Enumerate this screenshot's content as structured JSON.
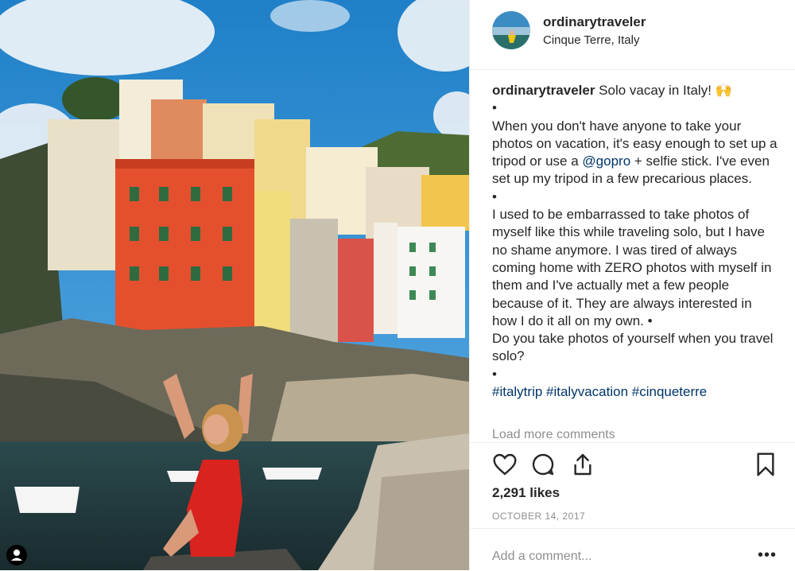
{
  "post": {
    "username": "ordinarytraveler",
    "location": "Cinque Terre, Italy",
    "caption": {
      "username": "ordinarytraveler",
      "line_intro": " Solo vacay in Italy! 🙌",
      "bullet": "•",
      "para1_a": "When you don't have anyone to take your photos on vacation, it's easy enough to set up a tripod or use a ",
      "mention": "@gopro",
      "para1_b": " + selfie stick. I've even set up my tripod in a few precarious places.",
      "para2": "I used to be embarrassed to take photos of myself like this while traveling solo, but I have no shame anymore. I was tired of always coming home with ZERO photos with myself in them and I've actually met a few people because of it. They are always interested in how I do it all on my own. •",
      "para3": "Do you take photos of yourself when you travel solo?",
      "hashtags": "#italytrip #italyvacation #cinqueterre"
    },
    "load_more": "Load more comments",
    "likes": "2,291 likes",
    "date": "OCTOBER 14, 2017",
    "add_comment_placeholder": "Add a comment...",
    "more_options": "•••"
  },
  "icons": {
    "like": "heart-icon",
    "comment": "comment-icon",
    "share": "share-icon",
    "save": "bookmark-icon",
    "tag": "user-tag-icon"
  },
  "colors": {
    "link": "#003569",
    "muted": "#8e8e8e",
    "text": "#262626",
    "border": "#efefef"
  }
}
